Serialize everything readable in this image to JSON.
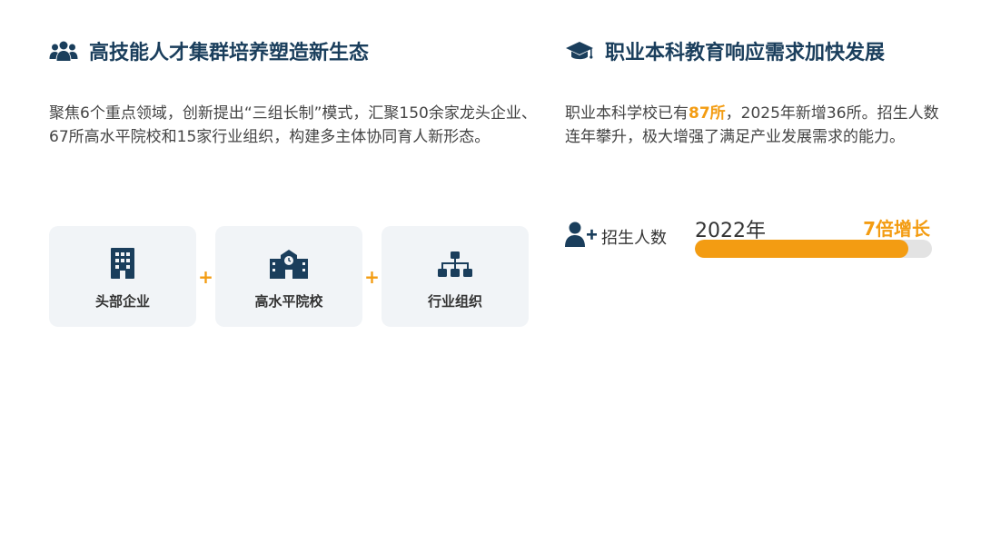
{
  "left": {
    "title": "高技能人才集群培养塑造新生态",
    "title_icon": "users-group-icon",
    "paragraph": "聚焦6个重点领域，创新提出“三组长制”模式，汇聚150余家龙头企业、67所高水平院校和15家行业组织，构建多主体协同育人新形态。",
    "cards": [
      {
        "label": "头部企业",
        "icon": "building-icon"
      },
      {
        "label": "高水平院校",
        "icon": "school-icon"
      },
      {
        "label": "行业组织",
        "icon": "sitemap-icon"
      }
    ],
    "plus": "+"
  },
  "right": {
    "title": "职业本科教育响应需求加快发展",
    "title_icon": "graduation-cap-icon",
    "paragraph_a": "职业本科学校已有",
    "paragraph_hl": "87所",
    "paragraph_b": "，2025年新增36所。招生人数连年攀升，极大增强了满足产业发展需求的能力。",
    "metric": {
      "label": "招生人数",
      "icon": "user-plus-icon",
      "year": "2022年",
      "growth": "7倍增长",
      "progress": 0.9
    }
  },
  "colors": {
    "accent": "#f39c12",
    "title": "#1a3e5c",
    "icon": "#1a3e5c",
    "card_bg": "#f1f4f7",
    "track": "#e3e3e3"
  }
}
